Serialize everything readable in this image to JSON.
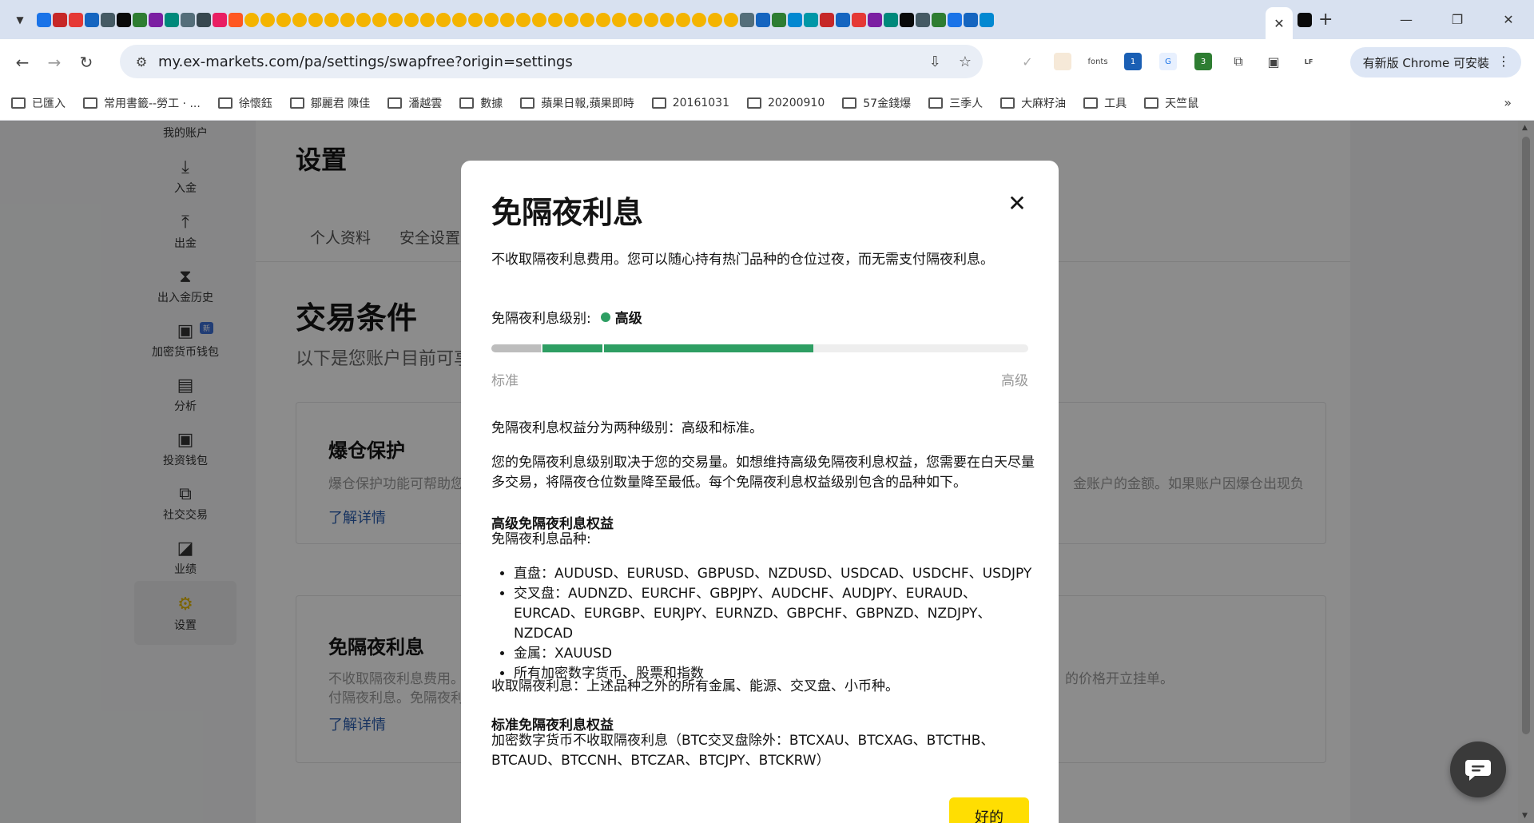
{
  "browser": {
    "tab_menu_icon": "chevron-down-icon",
    "new_tab_label": "+",
    "close_tab_label": "✕",
    "window_controls": {
      "minimize": "—",
      "restore": "❐",
      "close": "✕"
    },
    "url": "my.ex-markets.com/pa/settings/swapfree?origin=settings",
    "extensions": [
      "fonts",
      "1",
      "3"
    ],
    "update_label": "有新版 Chrome 可安裝",
    "bookmarks": [
      "已匯入",
      "常用書籤--勞工 · ...",
      "徐懷鈺",
      "鄒麗君 陳佳",
      "潘越雲",
      "數據",
      "蘋果日報,蘋果即時",
      "20161031",
      "20200910",
      "57金錢爆",
      "三季人",
      "大麻籽油",
      "工具",
      "天竺鼠"
    ],
    "bookmarks_more": "»"
  },
  "sidebar": {
    "items": [
      {
        "label": "我的账户",
        "icon": "user-icon"
      },
      {
        "label": "入金",
        "icon": "deposit-icon"
      },
      {
        "label": "出金",
        "icon": "withdraw-icon"
      },
      {
        "label": "出入金历史",
        "icon": "hourglass-icon"
      },
      {
        "label": "加密货币钱包",
        "icon": "wallet-icon",
        "badge": "新"
      },
      {
        "label": "分析",
        "icon": "analysis-icon"
      },
      {
        "label": "投资钱包",
        "icon": "wallet-icon"
      },
      {
        "label": "社交交易",
        "icon": "copy-icon"
      },
      {
        "label": "业绩",
        "icon": "chart-icon"
      },
      {
        "label": "设置",
        "icon": "gear-icon"
      }
    ]
  },
  "page": {
    "title": "设置",
    "tabs": [
      "个人资料",
      "安全设置"
    ],
    "section_title": "交易条件",
    "section_sub": "以下是您账户目前可享",
    "cards": [
      {
        "title": "爆仓保护",
        "desc_left": "爆仓保护功能可帮助您",
        "desc_right": "金账户的金额。如果账户因爆仓出现负",
        "link": "了解详情"
      },
      {
        "title": "免隔夜利息",
        "desc_left": "不收取隔夜利息费用。",
        "desc_left2": "付隔夜利息。免隔夜利",
        "desc_right": "的价格开立挂单。",
        "link": "了解详情"
      }
    ]
  },
  "modal": {
    "title": "免隔夜利息",
    "intro": "不收取隔夜利息费用。您可以随心持有热门品种的仓位过夜，而无需支付隔夜利息。",
    "level_label": "免隔夜利息级别:",
    "level_value": "高级",
    "level_color": "#2e9e63",
    "bar_min_label": "标准",
    "bar_max_label": "高级",
    "progress_fraction": 0.6,
    "para1": "免隔夜利息权益分为两种级别：高级和标准。",
    "para2": "您的免隔夜利息级别取决于您的交易量。如想维持高级免隔夜利息权益，您需要在白天尽量多交易，将隔夜仓位数量降至最低。每个免隔夜利息权益级别包含的品种如下。",
    "premium_title": "高级免隔夜利息权益",
    "premium_sub": "免隔夜利息品种:",
    "premium_list": [
      "直盘：AUDUSD、EURUSD、GBPUSD、NZDUSD、USDCAD、USDCHF、USDJPY",
      "交叉盘：AUDNZD、EURCHF、GBPJPY、AUDCHF、AUDJPY、EURAUD、EURCAD、EURGBP、EURJPY、EURNZD、GBPCHF、GBPNZD、NZDJPY、NZDCAD",
      "金属：XAUUSD",
      "所有加密数字货币、股票和指数"
    ],
    "premium_charge": "收取隔夜利息：上述品种之外的所有金属、能源、交叉盘、小币种。",
    "standard_title": "标准免隔夜利息权益",
    "standard_text": "加密数字货币不收取隔夜利息（BTC交叉盘除外：BTCXAU、BTCXAG、BTCTHB、BTCAUD、BTCCNH、BTCZAR、BTCJPY、BTCKRW）",
    "ok_label": "好的",
    "accent_color": "#ffde02"
  },
  "chat": {
    "icon": "chat-icon"
  }
}
